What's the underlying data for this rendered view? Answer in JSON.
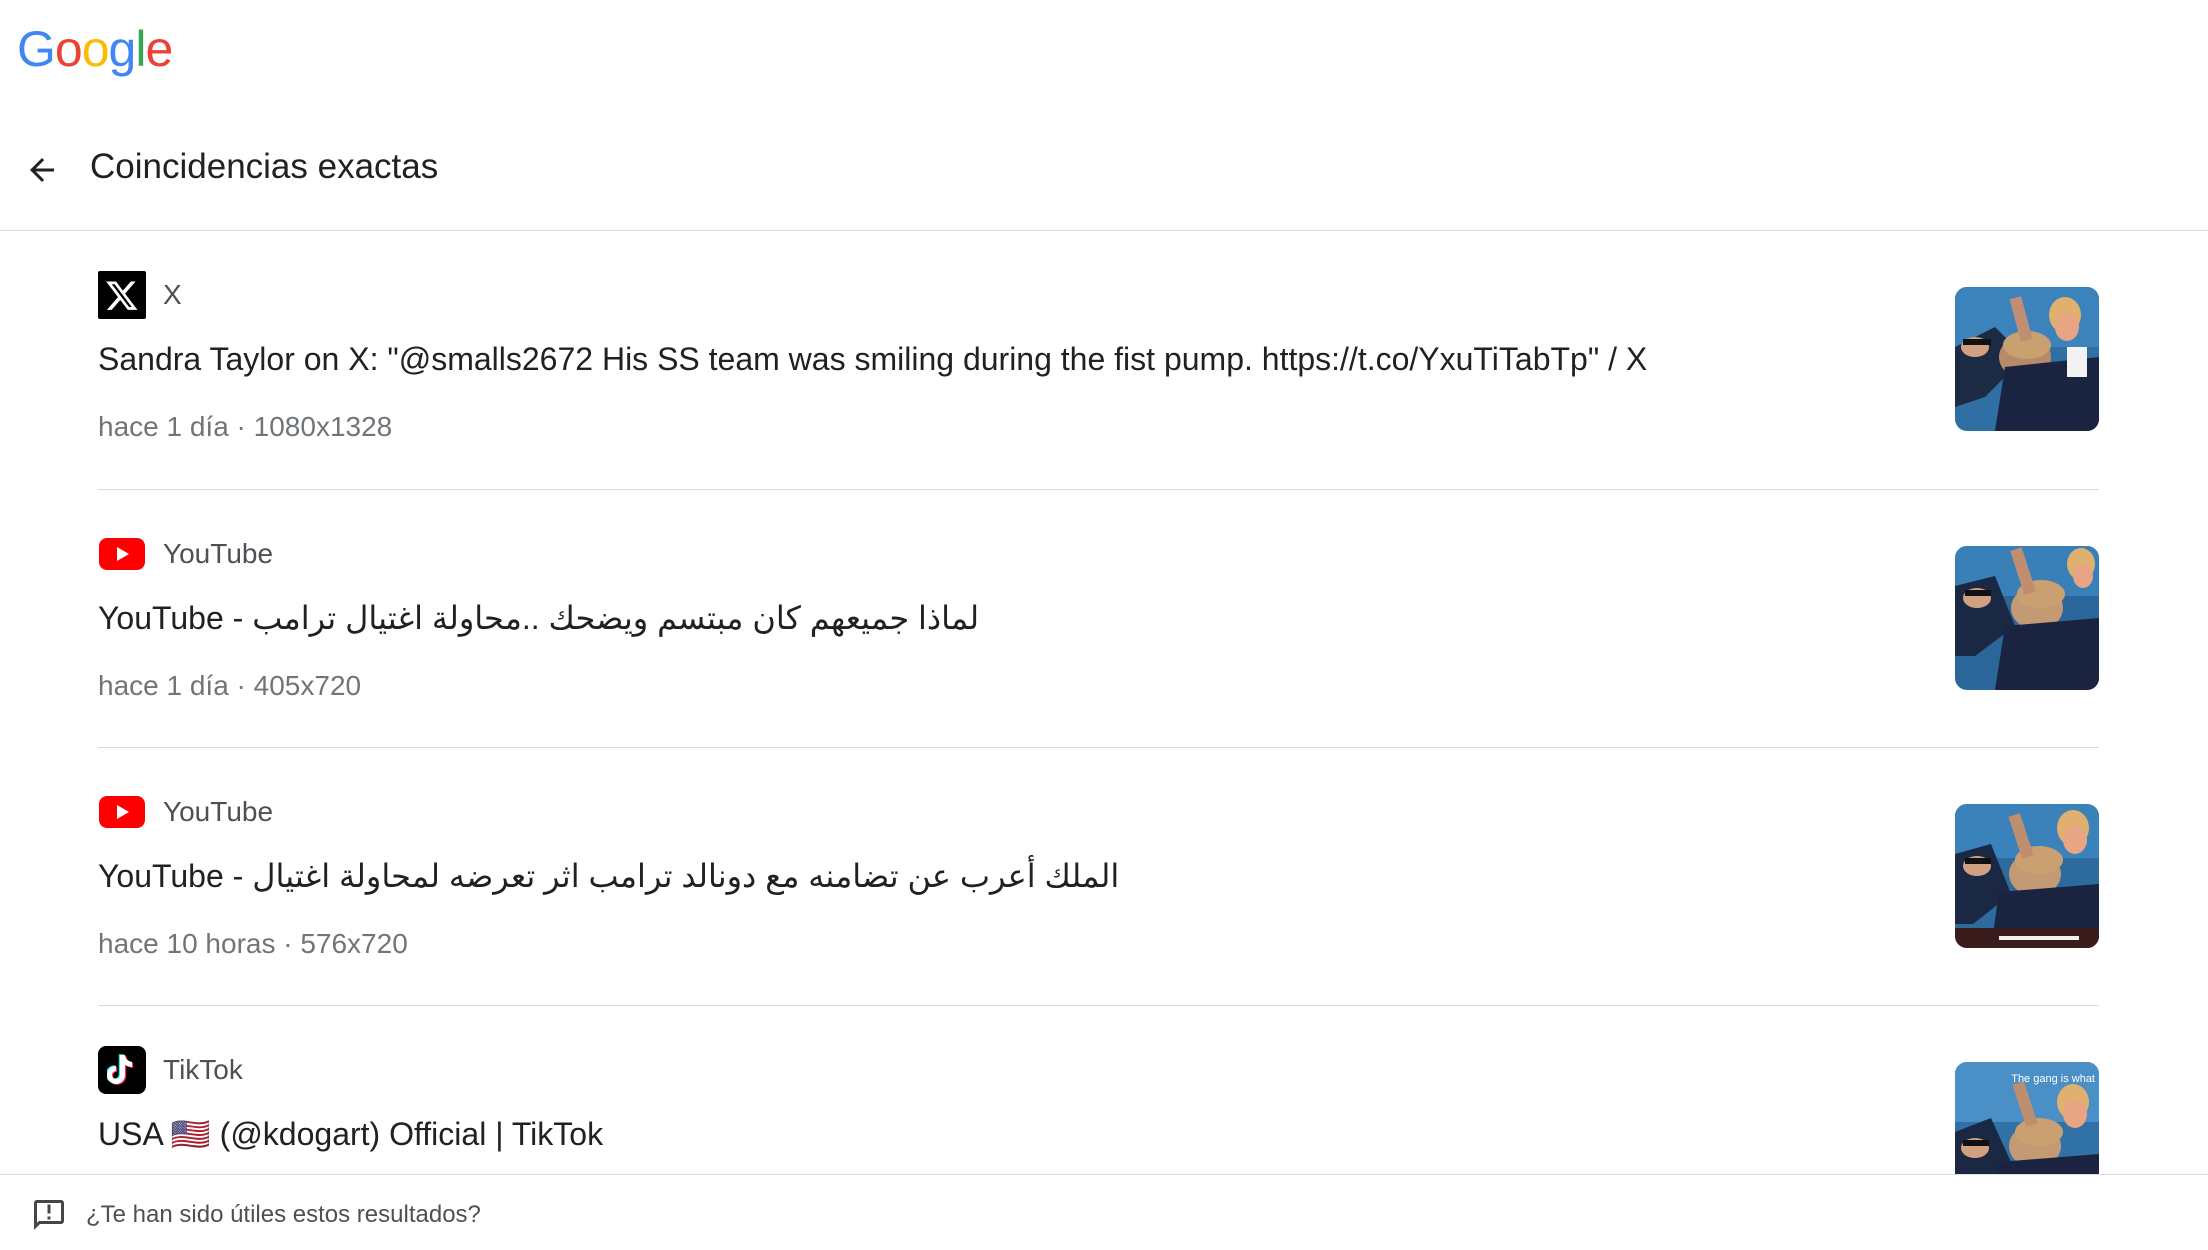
{
  "app": {
    "logo_letters": [
      "G",
      "o",
      "o",
      "g",
      "l",
      "e"
    ],
    "logo_colors": [
      "#4285F4",
      "#EA4335",
      "#FBBC05",
      "#4285F4",
      "#34A853",
      "#EA4335"
    ]
  },
  "header": {
    "back_icon": "arrow-back-icon",
    "title": "Coincidencias exactas"
  },
  "results": [
    {
      "source": "X",
      "favicon": "x-logo-icon",
      "title": "Sandra Taylor on X: \"@smalls2672 His SS team was smiling during the fist pump. https://t.co/YxuTiTabTp\" / X",
      "meta": "hace 1 día · 1080x1328"
    },
    {
      "source": "YouTube",
      "favicon": "youtube-logo-icon",
      "title_prefix": "YouTube - ",
      "title_rtl": "لماذا جميعهم كان مبتسم ويضحك ..محاولة اغتيال ترامب",
      "meta": "hace 1 día · 405x720"
    },
    {
      "source": "YouTube",
      "favicon": "youtube-logo-icon",
      "title_prefix": "YouTube - ",
      "title_rtl": "الملك أعرب عن تضامنه مع دونالد ترامب اثر تعرضه لمحاولة اغتيال",
      "meta": "hace 10 horas · 576x720"
    },
    {
      "source": "TikTok",
      "favicon": "tiktok-logo-icon",
      "title": "USA 🇺🇸 (@kdogart) Official | TikTok",
      "thumb_caption": "The gang is what"
    }
  ],
  "feedback": {
    "icon": "feedback-icon",
    "text": "¿Te han sido útiles estos resultados?"
  },
  "colors": {
    "youtube_red": "#FF0000",
    "x_black": "#000000",
    "tiktok_black": "#010101",
    "divider": "#dadce0"
  }
}
